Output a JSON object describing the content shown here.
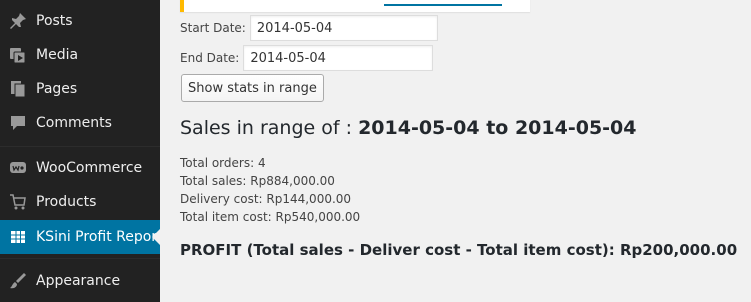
{
  "sidebar": {
    "items": [
      {
        "label": "Posts",
        "icon": "pin-icon",
        "active": false
      },
      {
        "label": "Media",
        "icon": "media-icon",
        "active": false
      },
      {
        "label": "Pages",
        "icon": "pages-icon",
        "active": false
      },
      {
        "label": "Comments",
        "icon": "comment-icon",
        "active": false
      },
      {
        "label": "WooCommerce",
        "icon": "woo-icon",
        "active": false
      },
      {
        "label": "Products",
        "icon": "cart-icon",
        "active": false
      },
      {
        "label": "KSini Profit Report",
        "icon": "table-icon",
        "active": true
      },
      {
        "label": "Appearance",
        "icon": "brush-icon",
        "active": false
      }
    ],
    "colors": {
      "background": "#222222",
      "active": "#0074a2",
      "text": "#eeeeee",
      "icon": "#999999"
    }
  },
  "form": {
    "start_label": "Start Date:",
    "start_value": "2014-05-04",
    "end_label": "End Date:",
    "end_value": "2014-05-04",
    "button_label": "Show stats in range"
  },
  "results": {
    "heading_prefix": "Sales in range of : ",
    "heading_range": "2014-05-04 to 2014-05-04",
    "total_orders": "Total orders: 4",
    "total_sales": "Total sales: Rp884,000.00",
    "delivery_cost": "Delivery cost: Rp144,000.00",
    "total_item_cost": "Total item cost: Rp540,000.00",
    "profit": "PROFIT (Total sales - Deliver cost - Total item cost): Rp200,000.00"
  },
  "colors": {
    "notice_border": "#ffba00",
    "link": "#0074a2",
    "page_bg": "#f1f1f1"
  }
}
